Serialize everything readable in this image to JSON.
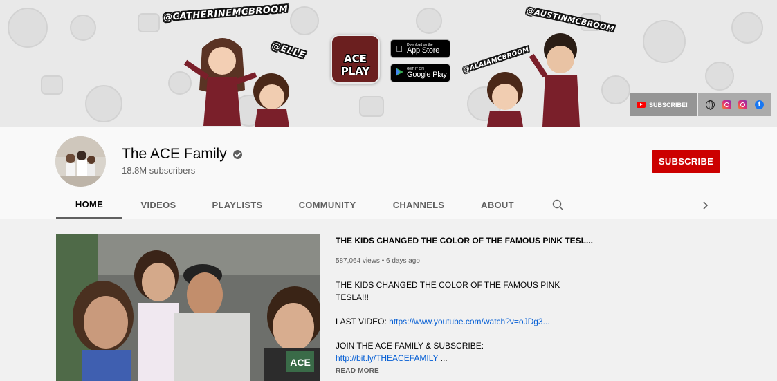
{
  "banner": {
    "handles": {
      "catherine": "@CATHERINEMCBROOM",
      "elle": "@ELLE",
      "alaia": "@ALAIAMCBROOM",
      "austin": "@AUSTINMCBROOM"
    },
    "app_icon_text": "ACE PLAY",
    "app_store": {
      "small": "Download on the",
      "big": "App Store"
    },
    "google_play": {
      "small": "GET IT ON",
      "big": "Google Play"
    },
    "subscribe_link": "SUBSCRIBE!"
  },
  "channel": {
    "title": "The ACE Family",
    "subscribers": "18.8M subscribers",
    "subscribe_label": "SUBSCRIBE"
  },
  "tabs": [
    {
      "label": "HOME",
      "active": true
    },
    {
      "label": "VIDEOS"
    },
    {
      "label": "PLAYLISTS"
    },
    {
      "label": "COMMUNITY"
    },
    {
      "label": "CHANNELS"
    },
    {
      "label": "ABOUT"
    }
  ],
  "featured": {
    "title": "THE KIDS CHANGED THE COLOR OF THE FAMOUS PINK TESL...",
    "meta": "587,064 views • 6 days ago",
    "desc_line1": "THE KIDS CHANGED THE COLOR OF THE FAMOUS PINK",
    "desc_line2": "TESLA!!!",
    "last_video_label": "LAST VIDEO: ",
    "last_video_link": "https://www.youtube.com/watch?v=oJDg3...",
    "join_label": "JOIN THE ACE FAMILY & SUBSCRIBE:",
    "join_link": "http://bit.ly/THEACEFAMILY",
    "join_link_suffix": " ...",
    "read_more": "READ MORE",
    "thumb_badge": "ACE"
  },
  "colors": {
    "accent_red": "#cc0000",
    "link_blue": "#065fd4"
  },
  "icons": [
    "verified-icon",
    "search-icon",
    "chevron-right-icon",
    "youtube-icon",
    "globe-icon",
    "instagram-icon",
    "facebook-icon",
    "apple-icon",
    "google-play-icon"
  ]
}
